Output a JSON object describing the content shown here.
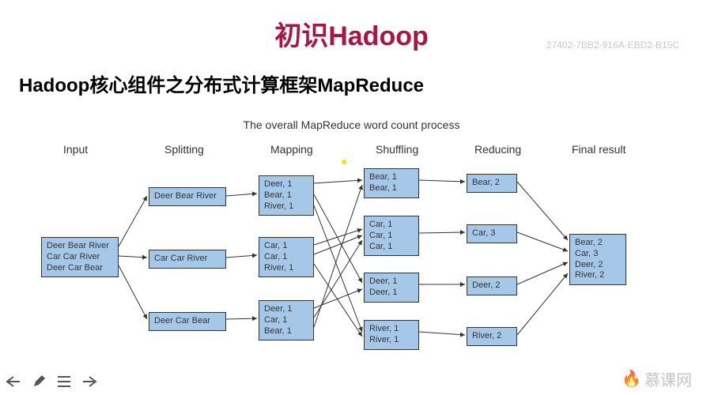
{
  "header": {
    "title": "初识Hadoop",
    "watermark": "27402-7BB2-916A-EBD2-B15C",
    "subtitle": "Hadoop核心组件之分布式计算框架MapReduce"
  },
  "diagram": {
    "title": "The overall MapReduce word count process",
    "columns": [
      "Input",
      "Splitting",
      "Mapping",
      "Shuffling",
      "Reducing",
      "Final result"
    ],
    "input_box": "Deer Bear River\nCar Car River\nDeer Car Bear",
    "splitting": [
      "Deer Bear River",
      "Car Car River",
      "Deer Car Bear"
    ],
    "mapping": [
      "Deer, 1\nBear, 1\nRiver, 1",
      "Car, 1\nCar, 1\nRiver, 1",
      "Deer, 1\nCar, 1\nBear, 1"
    ],
    "shuffling": [
      "Bear, 1\nBear, 1",
      "Car, 1\nCar, 1\nCar, 1",
      "Deer, 1\nDeer, 1",
      "River, 1\nRiver, 1"
    ],
    "reducing": [
      "Bear, 2",
      "Car, 3",
      "Deer, 2",
      "River, 2"
    ],
    "result": "Bear, 2\nCar, 3\nDeer, 2\nRiver, 2"
  },
  "brand": {
    "icon": "🔥",
    "text": "慕课网"
  }
}
